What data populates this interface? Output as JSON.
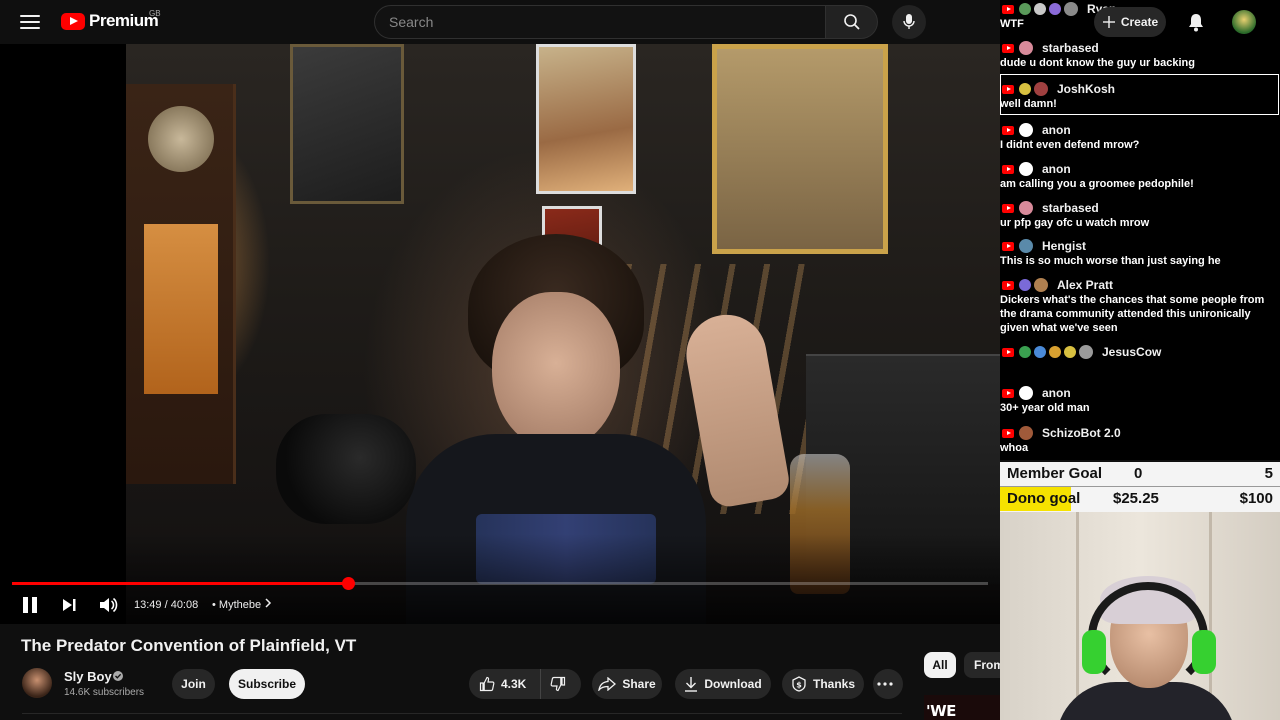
{
  "app": {
    "logo_text": "Premium",
    "logo_region": "GB",
    "search_placeholder": "Search",
    "create_label": "Create"
  },
  "player": {
    "time": "13:49 / 40:08",
    "chapter": "• Mythebe",
    "progress_fraction": 0.344,
    "buffer_fraction": 0.5
  },
  "video": {
    "title": "The Predator Convention of Plainfield, VT",
    "channel_name": "Sly Boy",
    "subscribers": "14.6K subscribers",
    "join_label": "Join",
    "subscribe_label": "Subscribe",
    "like_count": "4.3K",
    "share_label": "Share",
    "download_label": "Download",
    "thanks_label": "Thanks"
  },
  "chips": {
    "all": "All",
    "from": "From"
  },
  "thumb_peek_text": "'WE WERE",
  "chat": {
    "messages": [
      {
        "user": "Ryan",
        "text": "WTF"
      },
      {
        "user": "starbased",
        "text": "dude u dont know the guy ur backing"
      },
      {
        "user": "JoshKosh",
        "text": "well damn!"
      },
      {
        "user": "anon",
        "text": "I didnt even defend mrow?"
      },
      {
        "user": "anon",
        "text": "am calling you a groomee pedophile!"
      },
      {
        "user": "starbased",
        "text": "ur pfp gay ofc u watch mrow"
      },
      {
        "user": "Hengist",
        "text": "This is so much worse than just saying he"
      },
      {
        "user": "Alex Pratt",
        "text": "Dickers what's the chances that some people from the drama community attended this unironically given what we've seen"
      },
      {
        "user": "JesusCow",
        "text": ""
      },
      {
        "user": "anon",
        "text": "30+ year old man"
      },
      {
        "user": "SchizoBot 2.0",
        "text": "whoa"
      }
    ]
  },
  "goals": {
    "member": {
      "label": "Member Goal",
      "current": "0",
      "target": "5"
    },
    "dono": {
      "label": "Dono goal",
      "current": "$25.25",
      "target": "$100",
      "fraction": 0.2525
    }
  },
  "colors": {
    "accent_red": "#ff0000",
    "goal_yellow": "#f6e200",
    "background": "#0f0f0f"
  },
  "icons": [
    "menu-icon",
    "search-icon",
    "mic-icon",
    "create-plus-icon",
    "bell-icon",
    "pause-icon",
    "next-icon",
    "volume-icon",
    "chevron-right-icon",
    "verified-icon",
    "thumbs-up-icon",
    "thumbs-down-icon",
    "share-icon",
    "download-icon",
    "thanks-icon",
    "more-icon"
  ]
}
